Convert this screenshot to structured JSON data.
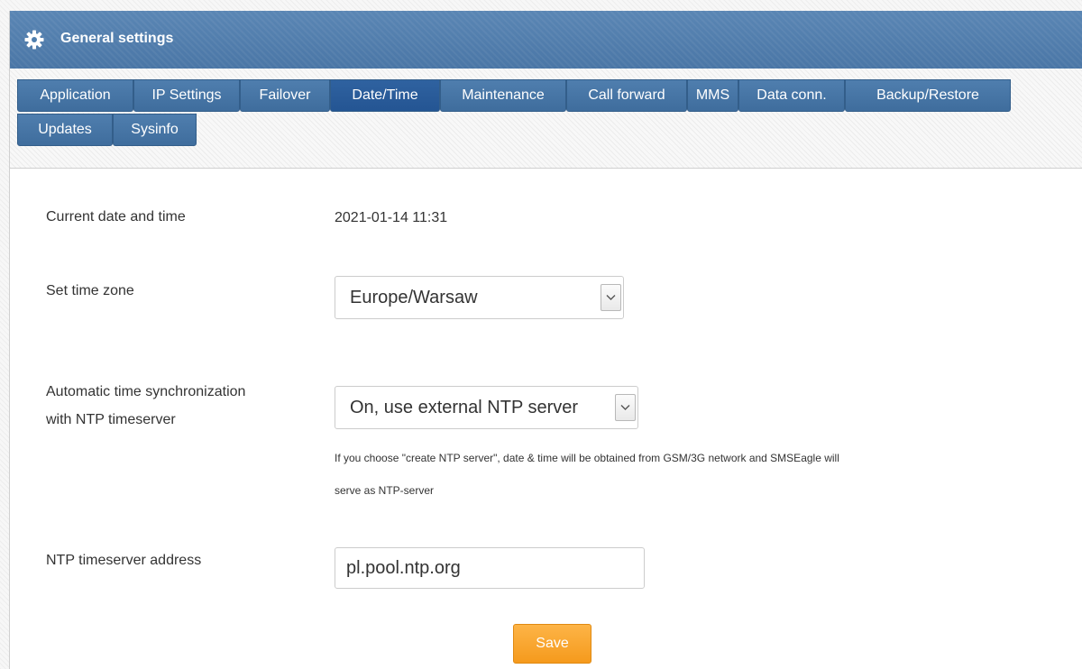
{
  "header": {
    "title": "General settings",
    "icon": "gear-icon"
  },
  "tabs": [
    {
      "label": "Application",
      "active": false
    },
    {
      "label": "IP Settings",
      "active": false
    },
    {
      "label": "Failover",
      "active": false
    },
    {
      "label": "Date/Time",
      "active": true
    },
    {
      "label": "Maintenance",
      "active": false
    },
    {
      "label": "Call forward",
      "active": false
    },
    {
      "label": "MMS",
      "active": false
    },
    {
      "label": "Data conn.",
      "active": false
    },
    {
      "label": "Backup/Restore",
      "active": false
    },
    {
      "label": "Updates",
      "active": false
    },
    {
      "label": "Sysinfo",
      "active": false
    }
  ],
  "form": {
    "current_datetime": {
      "label": "Current date and time",
      "value": "2021-01-14 11:31"
    },
    "timezone": {
      "label": "Set time zone",
      "selected": "Europe/Warsaw"
    },
    "ntp_sync": {
      "label_line1": "Automatic time synchronization",
      "label_line2": "with NTP timeserver",
      "selected": "On, use external NTP server",
      "help_line1": "If you choose \"create NTP server\", date & time will be obtained from GSM/3G network and SMSEagle will",
      "help_line2": "serve as NTP-server"
    },
    "ntp_address": {
      "label": "NTP timeserver address",
      "value": "pl.pool.ntp.org"
    },
    "save_label": "Save"
  },
  "colors": {
    "header_bg": "#4a76a6",
    "tab_bg": "#3f6d9d",
    "tab_active_bg": "#245593",
    "save_button": "#f59a1d"
  }
}
